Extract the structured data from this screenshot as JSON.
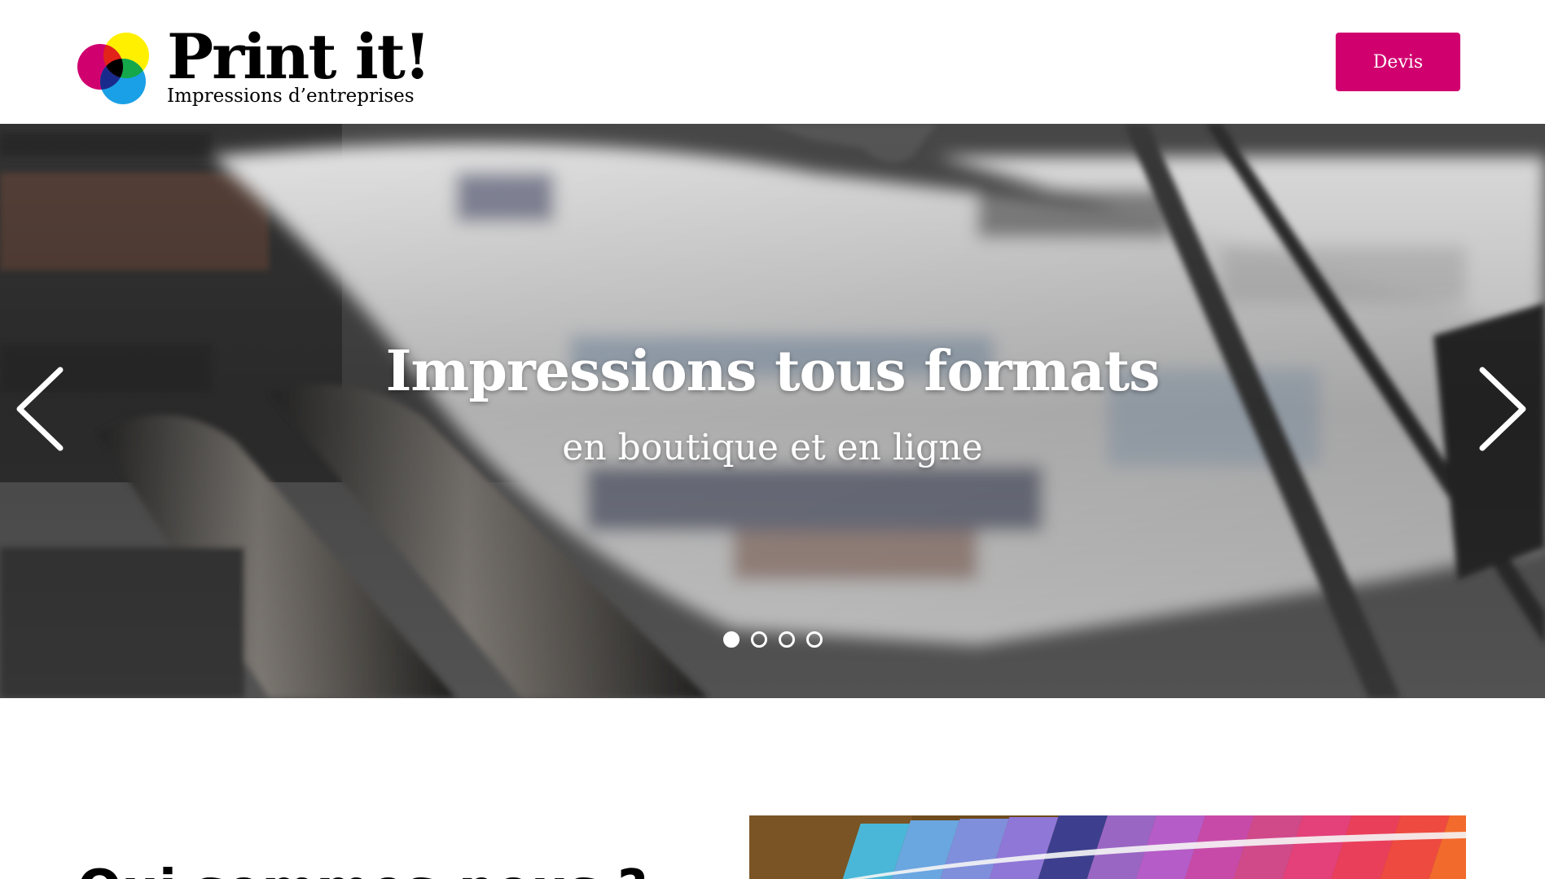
{
  "header": {
    "brand_title": "Print it!",
    "brand_subtitle": "Impressions d’entreprises",
    "cta_label": "Devis"
  },
  "banner": {
    "title": "Impressions tous formats",
    "subtitle": "en boutique et en ligne",
    "slide_count": 4,
    "active_slide": 1
  },
  "section": {
    "heading": "Qui sommes-nous ?"
  },
  "colors": {
    "brand_accent": "#d0006f",
    "logo_magenta": "#d0006f",
    "logo_yellow": "#fff000",
    "logo_green": "#14a84a",
    "logo_cyan": "#1aa0e6",
    "logo_black": "#000000"
  },
  "icons": {
    "prev": "chevron-left-icon",
    "next": "chevron-right-icon",
    "logo": "cmyk-circles-logo"
  }
}
